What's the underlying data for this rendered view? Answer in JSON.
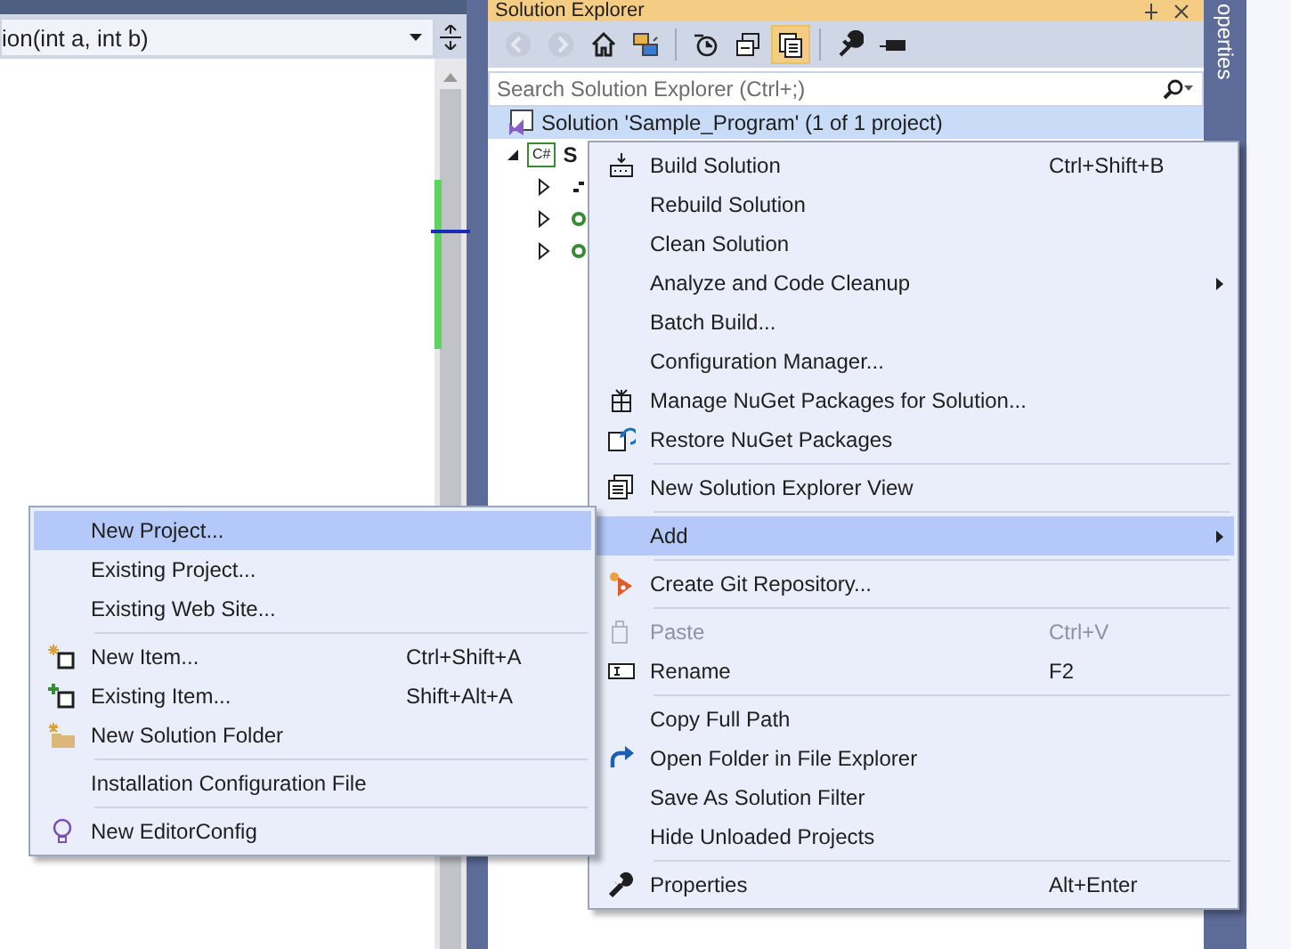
{
  "editor": {
    "member_dropdown": {
      "value": "ion(int a, int b)"
    }
  },
  "solution_explorer": {
    "title": "Solution Explorer",
    "toolbar": [
      {
        "disabled": true,
        "pressed": false
      },
      {
        "disabled": true,
        "pressed": false
      },
      {
        "disabled": false,
        "pressed": false
      },
      {
        "disabled": false,
        "pressed": false
      },
      {
        "disabled": false,
        "pressed": false
      },
      {
        "disabled": false,
        "pressed": false
      },
      {
        "disabled": false,
        "pressed": true
      },
      {
        "disabled": false,
        "pressed": false
      },
      {
        "disabled": false,
        "pressed": false
      }
    ],
    "search": {
      "placeholder": "Search Solution Explorer (Ctrl+;)"
    },
    "tree": [
      {
        "label": "Solution 'Sample_Program' (1 of 1 project)",
        "selected": true,
        "children": [
          {
            "label": "S",
            "badge": "C#",
            "selected": false,
            "expanded": true,
            "children": [
              {
                "selected": false,
                "expanded": false
              },
              {
                "selected": false,
                "expanded": false
              },
              {
                "selected": false,
                "expanded": false
              }
            ]
          }
        ]
      }
    ]
  },
  "side_tab": {
    "label": "operties"
  },
  "context_menu": {
    "items": [
      {
        "kind": "command",
        "label": "Build Solution",
        "shortcut": "Ctrl+Shift+B",
        "submenu": false,
        "disabled": false,
        "selected": false
      },
      {
        "kind": "command",
        "label": "Rebuild Solution",
        "submenu": false,
        "disabled": false,
        "selected": false
      },
      {
        "kind": "command",
        "label": "Clean Solution",
        "submenu": false,
        "disabled": false,
        "selected": false
      },
      {
        "kind": "command",
        "label": "Analyze and Code Cleanup",
        "submenu": true,
        "disabled": false,
        "selected": false
      },
      {
        "kind": "command",
        "label": "Batch Build...",
        "submenu": false,
        "disabled": false,
        "selected": false
      },
      {
        "kind": "command",
        "label": "Configuration Manager...",
        "submenu": false,
        "disabled": false,
        "selected": false
      },
      {
        "kind": "command",
        "label": "Manage NuGet Packages for Solution...",
        "submenu": false,
        "disabled": false,
        "selected": false
      },
      {
        "kind": "command",
        "label": "Restore NuGet Packages",
        "submenu": false,
        "disabled": false,
        "selected": false
      },
      {
        "kind": "separator"
      },
      {
        "kind": "command",
        "label": "New Solution Explorer View",
        "submenu": false,
        "disabled": false,
        "selected": false
      },
      {
        "kind": "separator"
      },
      {
        "kind": "command",
        "label": "Add",
        "submenu": true,
        "disabled": false,
        "selected": true
      },
      {
        "kind": "separator"
      },
      {
        "kind": "command",
        "label": "Create Git Repository...",
        "submenu": false,
        "disabled": false,
        "selected": false
      },
      {
        "kind": "separator"
      },
      {
        "kind": "command",
        "label": "Paste",
        "shortcut": "Ctrl+V",
        "submenu": false,
        "disabled": true,
        "selected": false
      },
      {
        "kind": "command",
        "label": "Rename",
        "shortcut": "F2",
        "submenu": false,
        "disabled": false,
        "selected": false
      },
      {
        "kind": "separator"
      },
      {
        "kind": "command",
        "label": "Copy Full Path",
        "submenu": false,
        "disabled": false,
        "selected": false
      },
      {
        "kind": "command",
        "label": "Open Folder in File Explorer",
        "submenu": false,
        "disabled": false,
        "selected": false
      },
      {
        "kind": "command",
        "label": "Save As Solution Filter",
        "submenu": false,
        "disabled": false,
        "selected": false
      },
      {
        "kind": "command",
        "label": "Hide Unloaded Projects",
        "submenu": false,
        "disabled": false,
        "selected": false
      },
      {
        "kind": "separator"
      },
      {
        "kind": "command",
        "label": "Properties",
        "shortcut": "Alt+Enter",
        "submenu": false,
        "disabled": false,
        "selected": false
      }
    ]
  },
  "add_submenu": {
    "items": [
      {
        "kind": "command",
        "label": "New Project...",
        "submenu": false,
        "disabled": false,
        "selected": true
      },
      {
        "kind": "command",
        "label": "Existing Project...",
        "submenu": false,
        "disabled": false,
        "selected": false
      },
      {
        "kind": "command",
        "label": "Existing Web Site...",
        "submenu": false,
        "disabled": false,
        "selected": false
      },
      {
        "kind": "separator"
      },
      {
        "kind": "command",
        "label": "New Item...",
        "shortcut": "Ctrl+Shift+A",
        "submenu": false,
        "disabled": false,
        "selected": false
      },
      {
        "kind": "command",
        "label": "Existing Item...",
        "shortcut": "Shift+Alt+A",
        "submenu": false,
        "disabled": false,
        "selected": false
      },
      {
        "kind": "command",
        "label": "New Solution Folder",
        "submenu": false,
        "disabled": false,
        "selected": false
      },
      {
        "kind": "separator"
      },
      {
        "kind": "command",
        "label": "Installation Configuration File",
        "submenu": false,
        "disabled": false,
        "selected": false
      },
      {
        "kind": "separator"
      },
      {
        "kind": "command",
        "label": "New EditorConfig",
        "submenu": false,
        "disabled": false,
        "selected": false
      }
    ]
  }
}
